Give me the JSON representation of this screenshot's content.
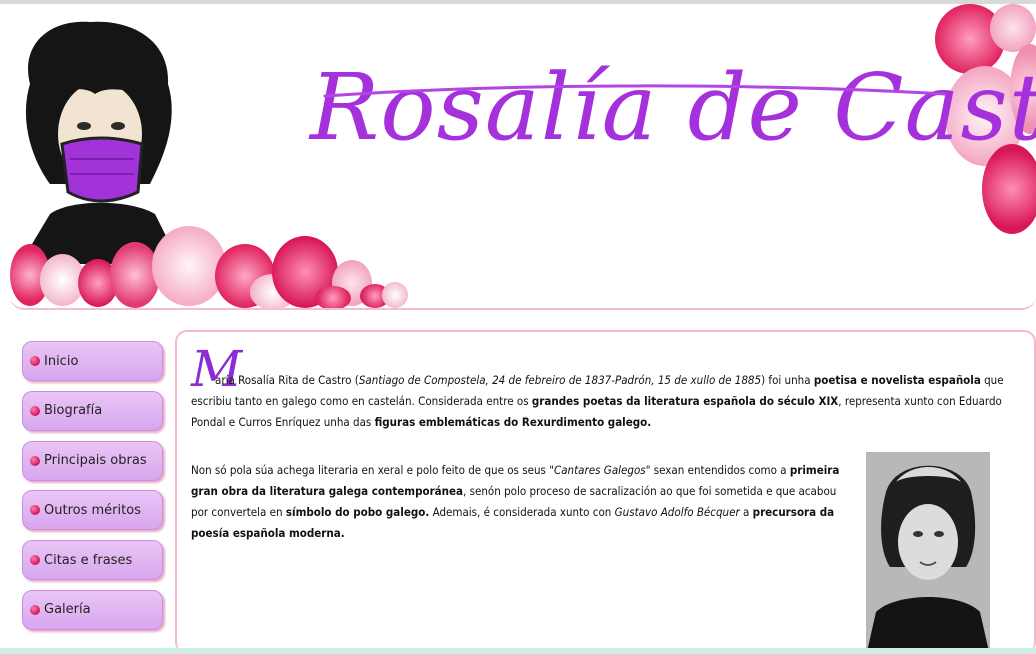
{
  "header": {
    "site_title": "Rosalía de Castro"
  },
  "nav": {
    "items": [
      {
        "label": "Inicio"
      },
      {
        "label": "Biografía"
      },
      {
        "label": "Principais obras"
      },
      {
        "label": "Outros méritos"
      },
      {
        "label": "Citas e frases"
      },
      {
        "label": "Galería"
      }
    ]
  },
  "content": {
    "dropcap": "M",
    "p1": {
      "t1": "aría Rosalía Rita de Castro (",
      "t2": "Santiago de Compostela, 24 de febreiro de 1837-Padrón, 15 de xullo de 1885",
      "t3": ") foi unha ",
      "t4": "poetisa e novelista española",
      "t5": " que escribiu tanto en galego como en castelán. Considerada entre os ",
      "t6": "grandes poetas da literatura española do século XIX",
      "t7": ", representa xunto con Eduardo Pondal e Curros Enríquez unha das ",
      "t8": "figuras emblemáticas do Rexurdimento galego."
    },
    "p2": {
      "t1": "Non só pola súa achega literaria en xeral e polo feito de que os seus ",
      "t2": "\"Cantares Galegos\"",
      "t3": " sexan entendidos como a ",
      "t4": "primeira gran obra da literatura galega contemporánea",
      "t5": ", senón polo proceso de sacralización ao que foi sometida e que acabou por convertela en ",
      "t6": "símbolo do pobo galego.",
      "t7": " Ademais, é considerada xunto con ",
      "t8": "Gustavo Adolfo Bécquer",
      "t9": " a ",
      "t10": "precursora da poesía española moderna."
    }
  },
  "colors": {
    "title_purple": "#a431dc",
    "nav_lilac": "#dcb0f0",
    "border_pink": "#f5b8cc",
    "flower_pink": "#e8306e"
  }
}
